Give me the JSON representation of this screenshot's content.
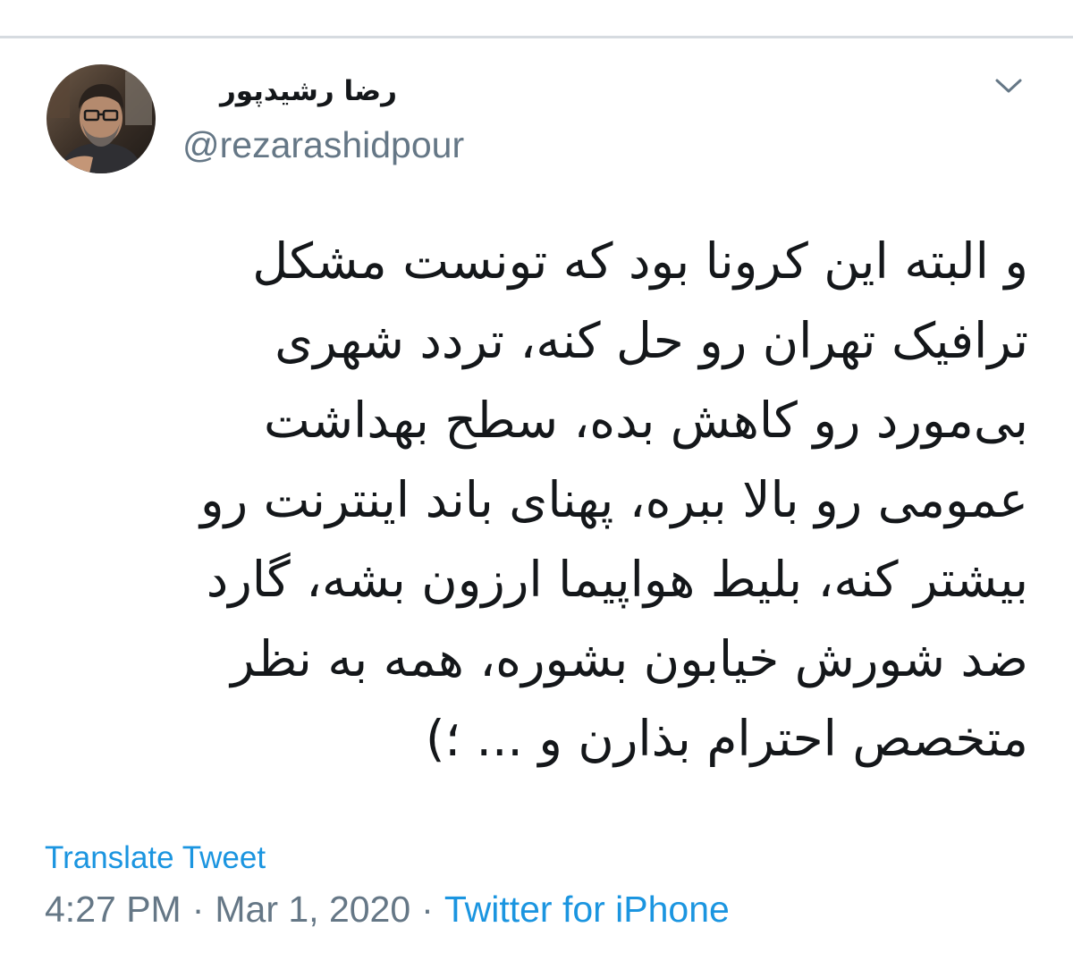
{
  "tweet": {
    "author": {
      "display_name": "رضا رشیدپور",
      "handle": "@rezarashidpour",
      "avatar_icon": "profile-photo"
    },
    "menu_icon": "chevron-down-icon",
    "text_lines": [
      "و البته این کرونا بود که تونست مشکل",
      "ترافیک تهران رو حل کنه، تردد شهری",
      "بی‌مورد رو کاهش بده، سطح بهداشت",
      "عمومی رو بالا ببره، پهنای باند اینترنت رو",
      "بیشتر کنه، بلیط هواپیما ارزون بشه، گارد",
      "ضد شورش خیابون بشوره، همه به نظر",
      "متخصص احترام بذارن و ... ؛)"
    ],
    "translate_label": "Translate Tweet",
    "time": "4:27 PM",
    "separator": "·",
    "date": "Mar 1, 2020",
    "source": "Twitter for iPhone"
  },
  "colors": {
    "link": "#1b95e0",
    "secondary_text": "#657786",
    "primary_text": "#14171a",
    "divider": "#d6dbe0"
  }
}
